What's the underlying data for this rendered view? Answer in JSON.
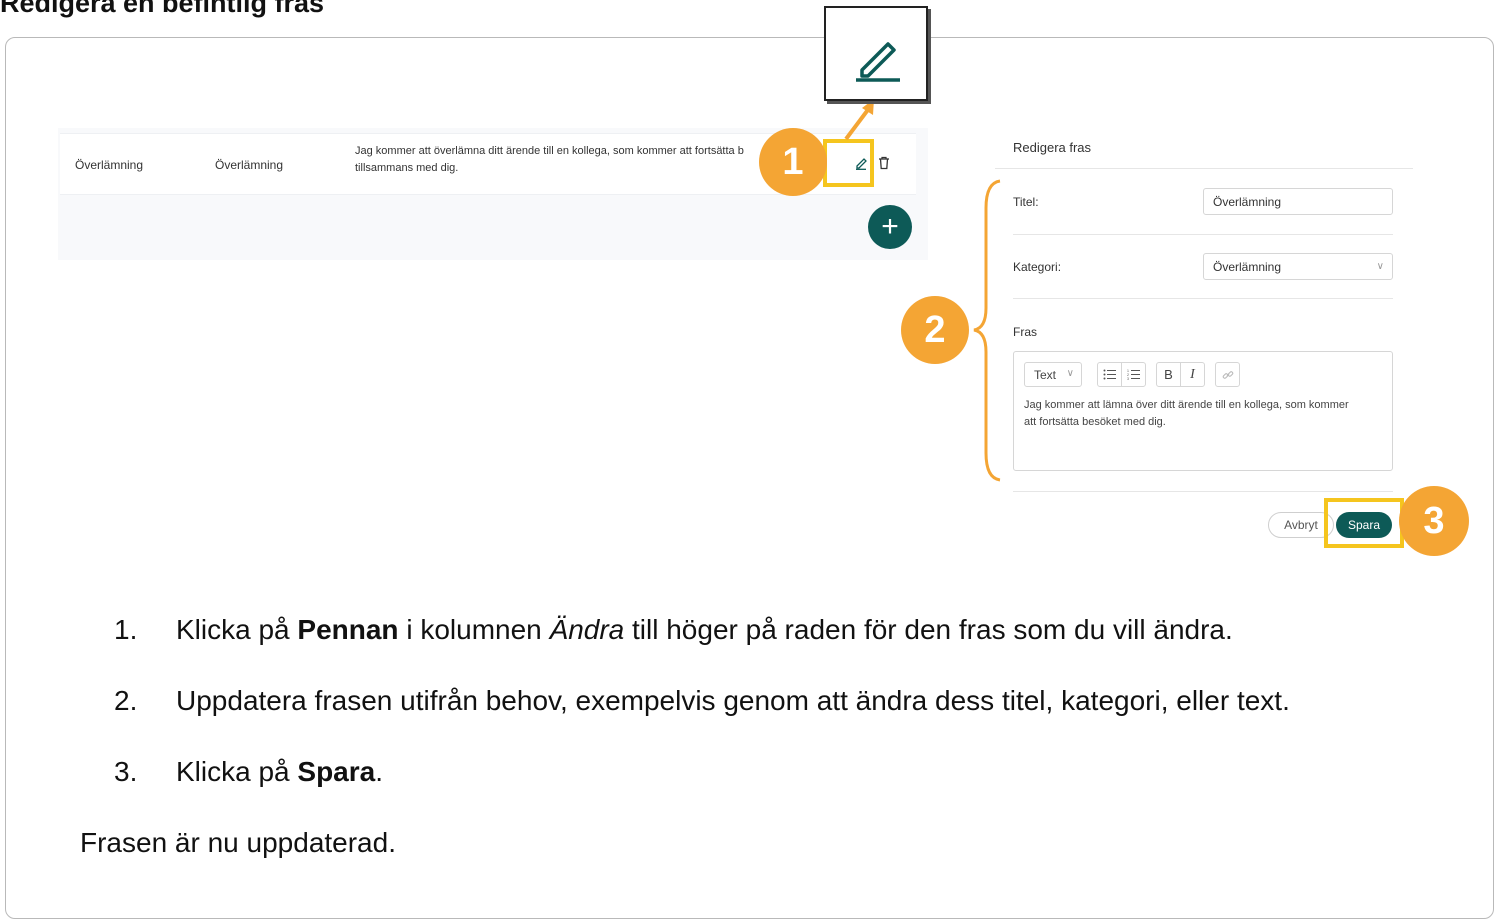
{
  "heading": "Redigera en befintlig fras",
  "table": {
    "row": {
      "title": "Överlämning",
      "category": "Överlämning",
      "text_line1": "Jag kommer att överlämna ditt ärende till en kollega, som kommer att fortsätta b",
      "text_line2": "tillsammans med dig."
    },
    "add_button": "+"
  },
  "badges": {
    "one": "1",
    "two": "2",
    "three": "3"
  },
  "form": {
    "title": "Redigera fras",
    "titel_label": "Titel:",
    "titel_value": "Överlämning",
    "kategori_label": "Kategori:",
    "kategori_value": "Överlämning",
    "fras_label": "Fras",
    "toolbar": {
      "text_style": "Text",
      "bold": "B",
      "italic": "I"
    },
    "editor_line1": "Jag kommer att lämna över ditt ärende till en kollega, som kommer",
    "editor_line2": "att fortsätta besöket med dig.",
    "cancel": "Avbryt",
    "save": "Spara"
  },
  "steps": [
    {
      "num": "1.",
      "pre": "Klicka på ",
      "bold": "Pennan",
      "mid": " i kolumnen ",
      "italic": "Ändra",
      "post": " till höger på raden för den fras som du vill ändra."
    },
    {
      "num": "2.",
      "text": "Uppdatera frasen utifrån behov, exempelvis genom att ändra dess titel, kategori, eller text."
    },
    {
      "num": "3.",
      "pre": "Klicka på ",
      "bold": "Spara",
      "post": "."
    }
  ],
  "note": "Frasen är nu uppdaterad.",
  "colors": {
    "accent": "#0d5a57",
    "badge": "#f4a534",
    "highlight": "#f5c51e"
  }
}
